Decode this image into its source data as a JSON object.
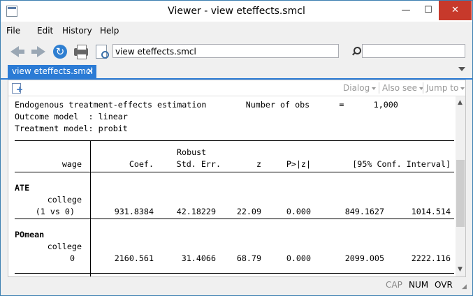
{
  "window": {
    "title": "Viewer - view eteffects.smcl",
    "minimize": "—",
    "maximize": "☐",
    "close": "✕"
  },
  "menu": [
    "File",
    "Edit",
    "History",
    "Help"
  ],
  "toolbar": {
    "command_value": "view eteffects.smcl",
    "search_value": ""
  },
  "tab": {
    "label": "view eteffects.smcl",
    "close": "✕"
  },
  "panel_toolbar": {
    "dialog": "Dialog",
    "also_see": "Also see",
    "jump_to": "Jump to"
  },
  "output": {
    "header_lines": [
      "Endogenous treatment-effects estimation        Number of obs      =      1,000",
      "Outcome model  : linear",
      "Treatment model: probit"
    ],
    "table": {
      "header_row1": {
        "stderr_top": "Robust"
      },
      "header_row2": {
        "var": "wage",
        "coef": "Coef.",
        "stderr": "Std. Err.",
        "z": "z",
        "p": "P>|z|",
        "ci": "[95% Conf. Interval]"
      },
      "sections": [
        {
          "title": "ATE",
          "sub": "college",
          "row_label": "(1 vs 0)",
          "coef": "931.8384",
          "stderr": "42.18229",
          "z": "22.09",
          "p": "0.000",
          "ci_lo": "849.1627",
          "ci_hi": "1014.514"
        },
        {
          "title": "POmean",
          "sub": "college",
          "row_label": "0",
          "coef": "2160.561",
          "stderr": "31.4066",
          "z": "68.79",
          "p": "0.000",
          "ci_lo": "2099.005",
          "ci_hi": "2222.116"
        }
      ]
    }
  },
  "status": {
    "cap": "CAP",
    "num": "NUM",
    "ovr": "OVR"
  },
  "colors": {
    "accent": "#2b7bd5",
    "close_button": "#c7392b"
  }
}
